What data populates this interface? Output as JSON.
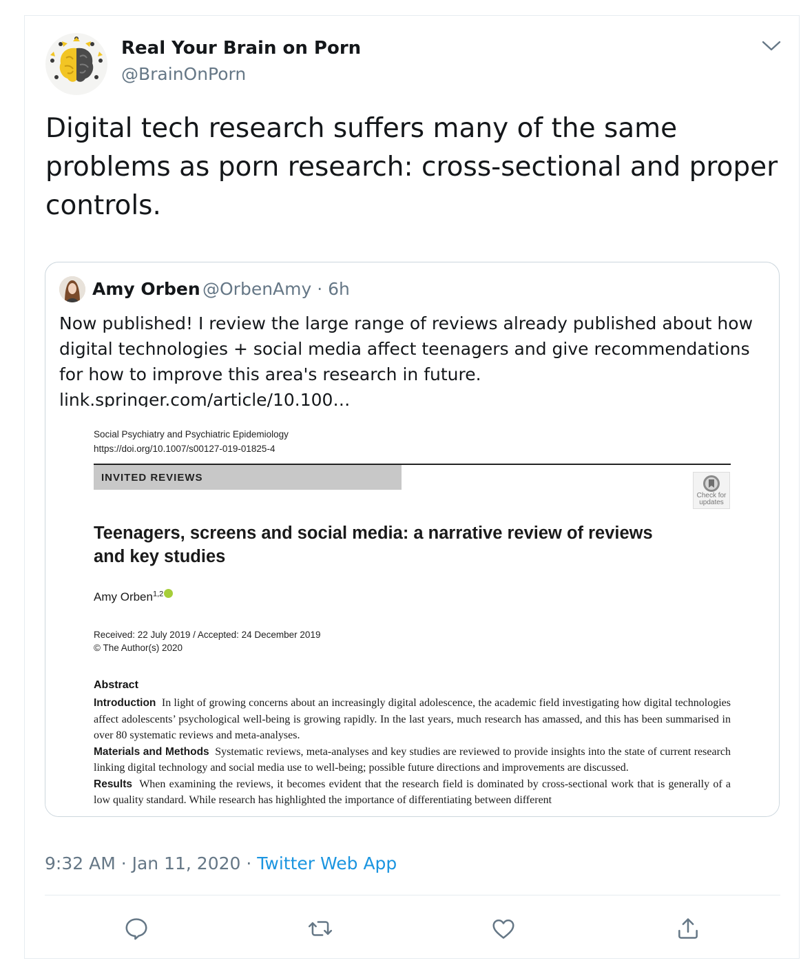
{
  "tweet": {
    "display_name": "Real Your Brain on Porn",
    "handle": "@BrainOnPorn",
    "text": "Digital tech research suffers many of the same problems as porn research: cross-sectional and proper controls.",
    "timestamp": "9:32 AM · Jan 11, 2020 · ",
    "source": "Twitter Web App"
  },
  "quoted": {
    "name": "Amy Orben",
    "handle_time": "@OrbenAmy · 6h",
    "text": "Now published! I review the large range of reviews already published about how digital technologies + social media affect teenagers and give recommendations for how to improve this area's research in future. link.springer.com/article/10.100…",
    "paper": {
      "journal": "Social Psychiatry and Psychiatric Epidemiology",
      "doi": "https://doi.org/10.1007/s00127-019-01825-4",
      "section": "INVITED REVIEWS",
      "check_line1": "Check for",
      "check_line2": "updates",
      "title": "Teenagers, screens and social media: a narrative review of reviews and key studies",
      "author": "Amy Orben",
      "author_sup": "1,2",
      "received": "Received: 22 July 2019 / Accepted: 24 December 2019",
      "copyright": "© The Author(s) 2020",
      "abstract_heading": "Abstract",
      "intro_label": "Introduction",
      "intro_text": "In light of growing concerns about an increasingly digital adolescence, the academic field investigating how digital technologies affect adolescents’ psychological well-being is growing rapidly. In the last years, much research has amassed, and this has been summarised in over 80 systematic reviews and meta-analyses.",
      "methods_label": "Materials and Methods",
      "methods_text": "Systematic reviews, meta-analyses and key studies are reviewed to provide insights into the state of current research linking digital technology and social media use to well-being; possible future directions and improvements are discussed.",
      "results_label": "Results",
      "results_text": "When examining the reviews, it becomes evident that the research field is dominated by cross-sectional work that is generally of a low quality standard. While research has highlighted the importance of differentiating between different"
    }
  },
  "icons": {
    "menu": "chevron-down-icon",
    "reply": "reply-icon",
    "retweet": "retweet-icon",
    "like": "heart-icon",
    "share": "share-icon"
  },
  "colors": {
    "text": "#14171a",
    "secondary": "#657786",
    "link": "#1b95e0",
    "border": "#ccd6dd"
  }
}
